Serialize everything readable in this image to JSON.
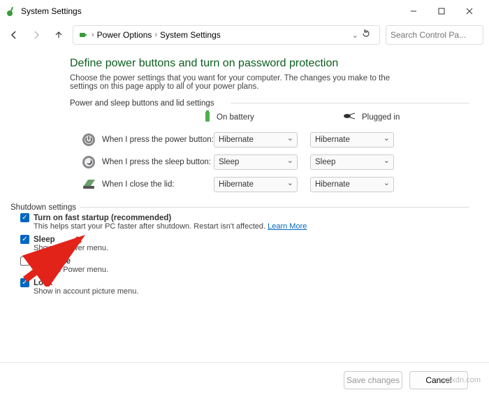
{
  "window": {
    "title": "System Settings"
  },
  "breadcrumb": {
    "item1": "Power Options",
    "item2": "System Settings"
  },
  "search": {
    "placeholder": "Search Control Pa..."
  },
  "heading": "Define power buttons and turn on password protection",
  "sub": "Choose the power settings that you want for your computer. The changes you make to the settings on this page apply to all of your power plans.",
  "section1": "Power and sleep buttons and lid settings",
  "cols": {
    "battery": "On battery",
    "plugged": "Plugged in"
  },
  "rows": {
    "power": {
      "label": "When I press the power button:",
      "bat": "Hibernate",
      "plug": "Hibernate"
    },
    "sleep": {
      "label": "When I press the sleep button:",
      "bat": "Sleep",
      "plug": "Sleep"
    },
    "lid": {
      "label": "When I close the lid:",
      "bat": "Hibernate",
      "plug": "Hibernate"
    }
  },
  "section2": "Shutdown settings",
  "checks": {
    "fast": {
      "label": "Turn on fast startup (recommended)",
      "desc_a": "This helps start your PC faster after shutdown. Restart isn't affected. ",
      "link": "Learn More",
      "checked": true
    },
    "sleep": {
      "label": "Sleep",
      "desc": "Show in Power menu.",
      "checked": true
    },
    "hib": {
      "label": "Hibernate",
      "desc": "Show in Power menu.",
      "checked": false
    },
    "lock": {
      "label": "Lock",
      "desc": "Show in account picture menu.",
      "checked": true
    }
  },
  "footer": {
    "save": "Save changes",
    "cancel": "Cancel"
  },
  "watermark": "wsxdn.com"
}
